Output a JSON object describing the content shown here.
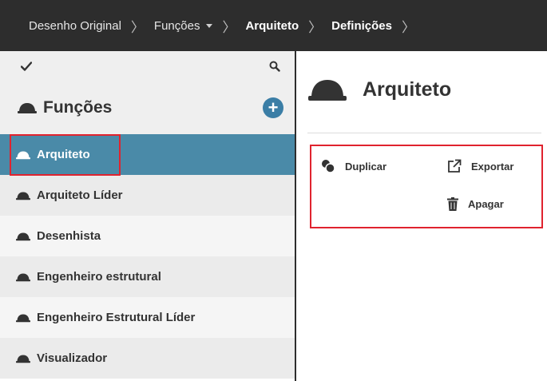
{
  "breadcrumb": [
    {
      "label": "Desenho Original"
    },
    {
      "label": "Funções"
    },
    {
      "label": "Arquiteto"
    },
    {
      "label": "Definições"
    }
  ],
  "sidebar": {
    "title": "Funções",
    "add_label": "+",
    "items": [
      {
        "label": "Arquiteto"
      },
      {
        "label": "Arquiteto Líder"
      },
      {
        "label": "Desenhista"
      },
      {
        "label": "Engenheiro estrutural"
      },
      {
        "label": "Engenheiro Estrutural Líder"
      },
      {
        "label": "Visualizador"
      }
    ]
  },
  "main": {
    "title": "Arquiteto",
    "actions": {
      "duplicate": "Duplicar",
      "export": "Exportar",
      "delete": "Apagar"
    }
  },
  "colors": {
    "topbar": "#2d2d2d",
    "accent": "#4a8aa8",
    "add_button": "#3b7ea6",
    "highlight": "#e0232e"
  },
  "icons": {
    "role": "hard-hat-icon",
    "toolbar_left": "check-icon",
    "toolbar_right": "search-icon"
  }
}
